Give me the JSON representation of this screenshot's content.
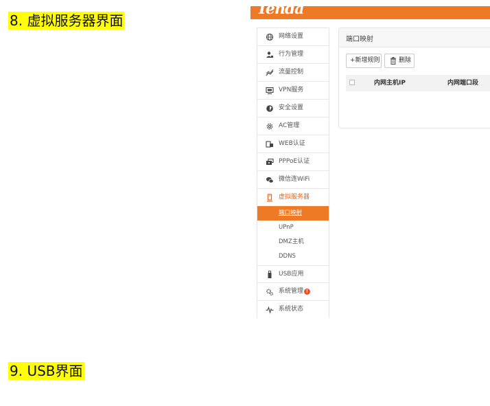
{
  "doc": {
    "heading_1": "8. 虚拟服务器界面",
    "heading_2": "9. USB界面"
  },
  "brand": {
    "logo_text": "Tenda",
    "accent_color": "#ee7a26"
  },
  "sidebar": {
    "items": [
      {
        "label": "网络设置",
        "icon": "globe-icon"
      },
      {
        "label": "行为管理",
        "icon": "user-manage-icon"
      },
      {
        "label": "流量控制",
        "icon": "traffic-icon"
      },
      {
        "label": "VPN服务",
        "icon": "monitor-icon"
      },
      {
        "label": "安全设置",
        "icon": "shield-icon"
      },
      {
        "label": "AC管理",
        "icon": "gear-icon"
      },
      {
        "label": "WEB认证",
        "icon": "web-auth-icon"
      },
      {
        "label": "PPPoE认证",
        "icon": "pppoe-icon"
      },
      {
        "label": "微信连WiFi",
        "icon": "wechat-icon"
      },
      {
        "label": "虚拟服务器",
        "icon": "server-icon",
        "expanded": true
      }
    ],
    "subitems": [
      {
        "label": "端口映射",
        "selected": true
      },
      {
        "label": "UPnP"
      },
      {
        "label": "DMZ主机"
      },
      {
        "label": "DDNS"
      }
    ],
    "bottom_items": [
      {
        "label": "USB应用",
        "icon": "usb-icon"
      },
      {
        "label": "系统管理",
        "icon": "system-gear-icon",
        "badge": "!"
      },
      {
        "label": "系统状态",
        "icon": "pulse-icon"
      }
    ]
  },
  "panel": {
    "title": "端口映射",
    "add_button": "+新增规则",
    "delete_button": "删除",
    "columns": [
      "内网主机IP",
      "内网端口段"
    ]
  }
}
